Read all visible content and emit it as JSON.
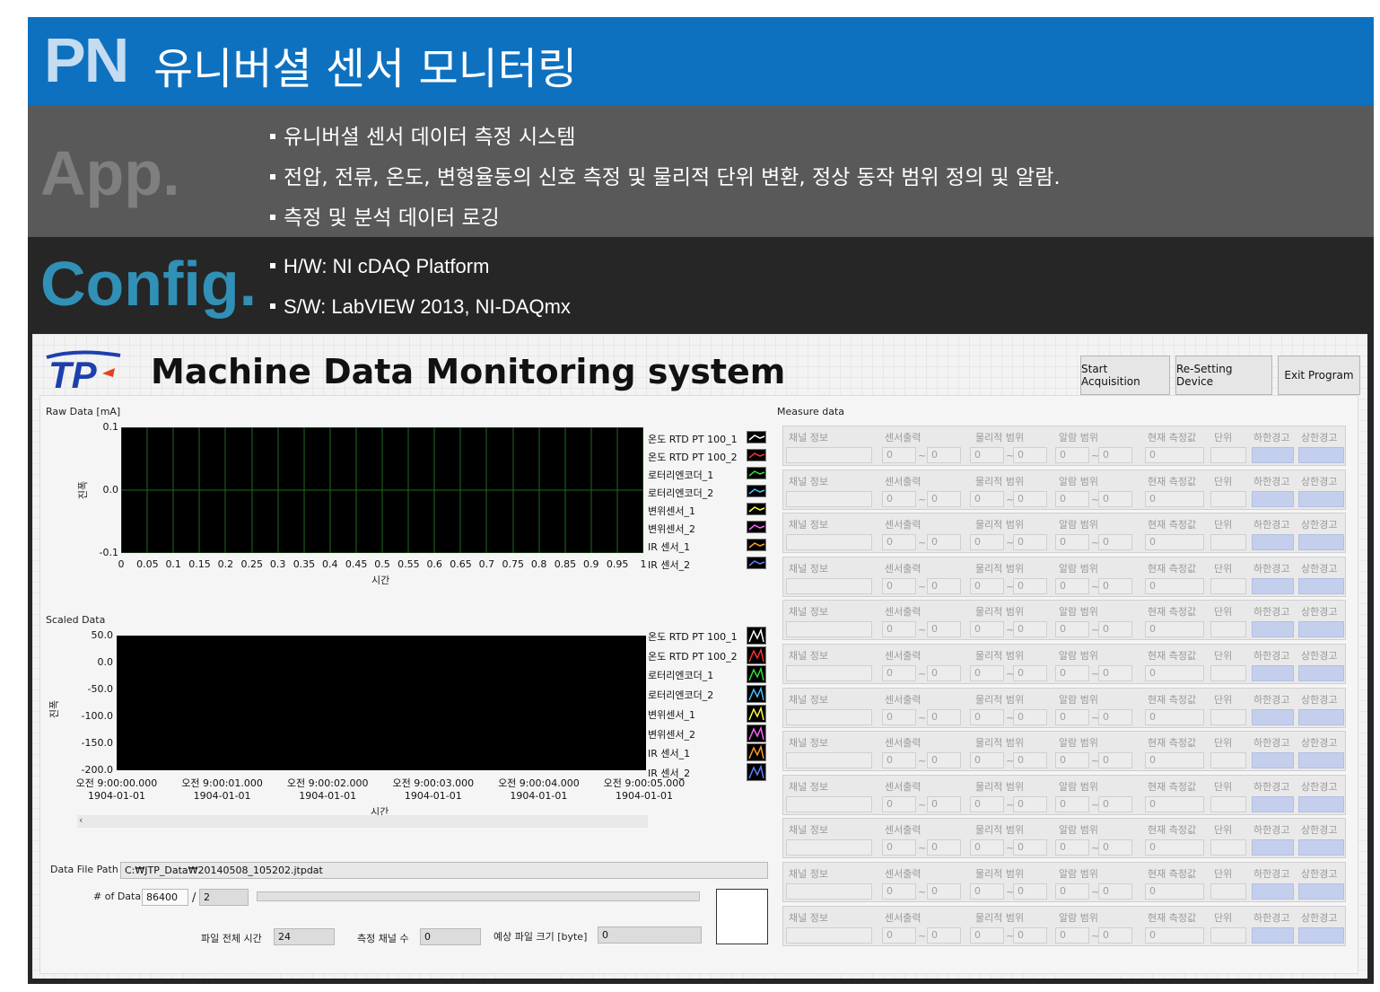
{
  "header": {
    "brand": "PN",
    "title": "유니버셜 센서 모니터링"
  },
  "app": {
    "label": "App.",
    "bullets": [
      "유니버셜 센서 데이터 측정 시스템",
      "전압, 전류, 온도, 변형율동의 신호 측정 및 물리적 단위 변환, 정상 동작 범위 정의 및 알람.",
      "측정 및 분석 데이터 로깅"
    ]
  },
  "config": {
    "label": "Config.",
    "bullets": [
      "H/W: NI cDAQ Platform",
      "S/W: LabVIEW 2013, NI-DAQmx"
    ]
  },
  "colors": {
    "header_bg": "#0e71c0",
    "app_bg": "#595959",
    "config_bg": "#262626",
    "config_label": "#3190b6",
    "alarm_lamp": "#c4cfee"
  },
  "window": {
    "logo_text": "TP",
    "title": "Machine Data Monitoring system",
    "buttons": {
      "start": "Start Acquisition",
      "reset": "Re-Setting Device",
      "exit": "Exit Program"
    }
  },
  "raw_plot": {
    "title": "Raw Data [mA]",
    "ylabel": "진폭",
    "xlabel": "시간",
    "yticks": [
      "0.1",
      "0.0",
      "-0.1"
    ],
    "xticks": [
      "0",
      "0.05",
      "0.1",
      "0.15",
      "0.2",
      "0.25",
      "0.3",
      "0.35",
      "0.4",
      "0.45",
      "0.5",
      "0.55",
      "0.6",
      "0.65",
      "0.7",
      "0.75",
      "0.8",
      "0.85",
      "0.9",
      "0.95",
      "1"
    ],
    "legend": [
      "온도 RTD PT 100_1",
      "온도 RTD PT 100_2",
      "로터리엔코더_1",
      "로터리엔코더_2",
      "변위센서_1",
      "변위센서_2",
      "IR 센서_1",
      "IR 센서_2"
    ],
    "legend_colors": [
      "#ffffff",
      "#ff3030",
      "#30e030",
      "#40c0ff",
      "#ffff40",
      "#ff60ff",
      "#ffa020",
      "#6080ff"
    ]
  },
  "scaled_plot": {
    "title": "Scaled Data",
    "ylabel": "진폭",
    "xlabel": "시간",
    "yticks": [
      "50.0",
      "0.0",
      "-50.0",
      "-100.0",
      "-150.0",
      "-200.0"
    ],
    "xticks": [
      {
        "time": "오전 9:00:00.000",
        "date": "1904-01-01"
      },
      {
        "time": "오전 9:00:01.000",
        "date": "1904-01-01"
      },
      {
        "time": "오전 9:00:02.000",
        "date": "1904-01-01"
      },
      {
        "time": "오전 9:00:03.000",
        "date": "1904-01-01"
      },
      {
        "time": "오전 9:00:04.000",
        "date": "1904-01-01"
      },
      {
        "time": "오전 9:00:05.000",
        "date": "1904-01-01"
      }
    ],
    "legend": [
      "온도 RTD PT 100_1",
      "온도 RTD PT 100_2",
      "로터리엔코더_1",
      "로터리엔코더_2",
      "변위센서_1",
      "변위센서_2",
      "IR 센서_1",
      "IR 센서_2"
    ],
    "legend_colors": [
      "#ffffff",
      "#ff3030",
      "#30e030",
      "#40c0ff",
      "#ffff40",
      "#ff60ff",
      "#ffa020",
      "#6080ff"
    ]
  },
  "file": {
    "path_label": "Data File Path",
    "path_value": "C:₩JTP_Data₩20140508_105202.jtpdat",
    "count_label": "# of Data",
    "count_value": "86400",
    "count_sep": "/",
    "count_total": "2",
    "total_time_label": "파일 전체 시간",
    "total_time_value": "24",
    "channels_label": "측정 채널 수",
    "channels_value": "0",
    "size_label": "예상 파일 크기 [byte]",
    "size_value": "0"
  },
  "measure": {
    "title": "Measure data",
    "headers": {
      "channel": "채널 정보",
      "sensor": "센서출력",
      "physical": "물리적 범위",
      "alarm": "알람 범위",
      "current": "현재 측정값",
      "unit": "단위",
      "low": "하한경고",
      "high": "상한경고"
    },
    "tilde": "~",
    "rows": [
      {
        "s1": "0",
        "s2": "0",
        "p1": "0",
        "p2": "0",
        "a1": "0",
        "a2": "0",
        "cur": "0"
      },
      {
        "s1": "0",
        "s2": "0",
        "p1": "0",
        "p2": "0",
        "a1": "0",
        "a2": "0",
        "cur": "0"
      },
      {
        "s1": "0",
        "s2": "0",
        "p1": "0",
        "p2": "0",
        "a1": "0",
        "a2": "0",
        "cur": "0"
      },
      {
        "s1": "0",
        "s2": "0",
        "p1": "0",
        "p2": "0",
        "a1": "0",
        "a2": "0",
        "cur": "0"
      },
      {
        "s1": "0",
        "s2": "0",
        "p1": "0",
        "p2": "0",
        "a1": "0",
        "a2": "0",
        "cur": "0"
      },
      {
        "s1": "0",
        "s2": "0",
        "p1": "0",
        "p2": "0",
        "a1": "0",
        "a2": "0",
        "cur": "0"
      },
      {
        "s1": "0",
        "s2": "0",
        "p1": "0",
        "p2": "0",
        "a1": "0",
        "a2": "0",
        "cur": "0"
      },
      {
        "s1": "0",
        "s2": "0",
        "p1": "0",
        "p2": "0",
        "a1": "0",
        "a2": "0",
        "cur": "0"
      },
      {
        "s1": "0",
        "s2": "0",
        "p1": "0",
        "p2": "0",
        "a1": "0",
        "a2": "0",
        "cur": "0"
      },
      {
        "s1": "0",
        "s2": "0",
        "p1": "0",
        "p2": "0",
        "a1": "0",
        "a2": "0",
        "cur": "0"
      },
      {
        "s1": "0",
        "s2": "0",
        "p1": "0",
        "p2": "0",
        "a1": "0",
        "a2": "0",
        "cur": "0"
      },
      {
        "s1": "0",
        "s2": "0",
        "p1": "0",
        "p2": "0",
        "a1": "0",
        "a2": "0",
        "cur": "0"
      }
    ]
  }
}
